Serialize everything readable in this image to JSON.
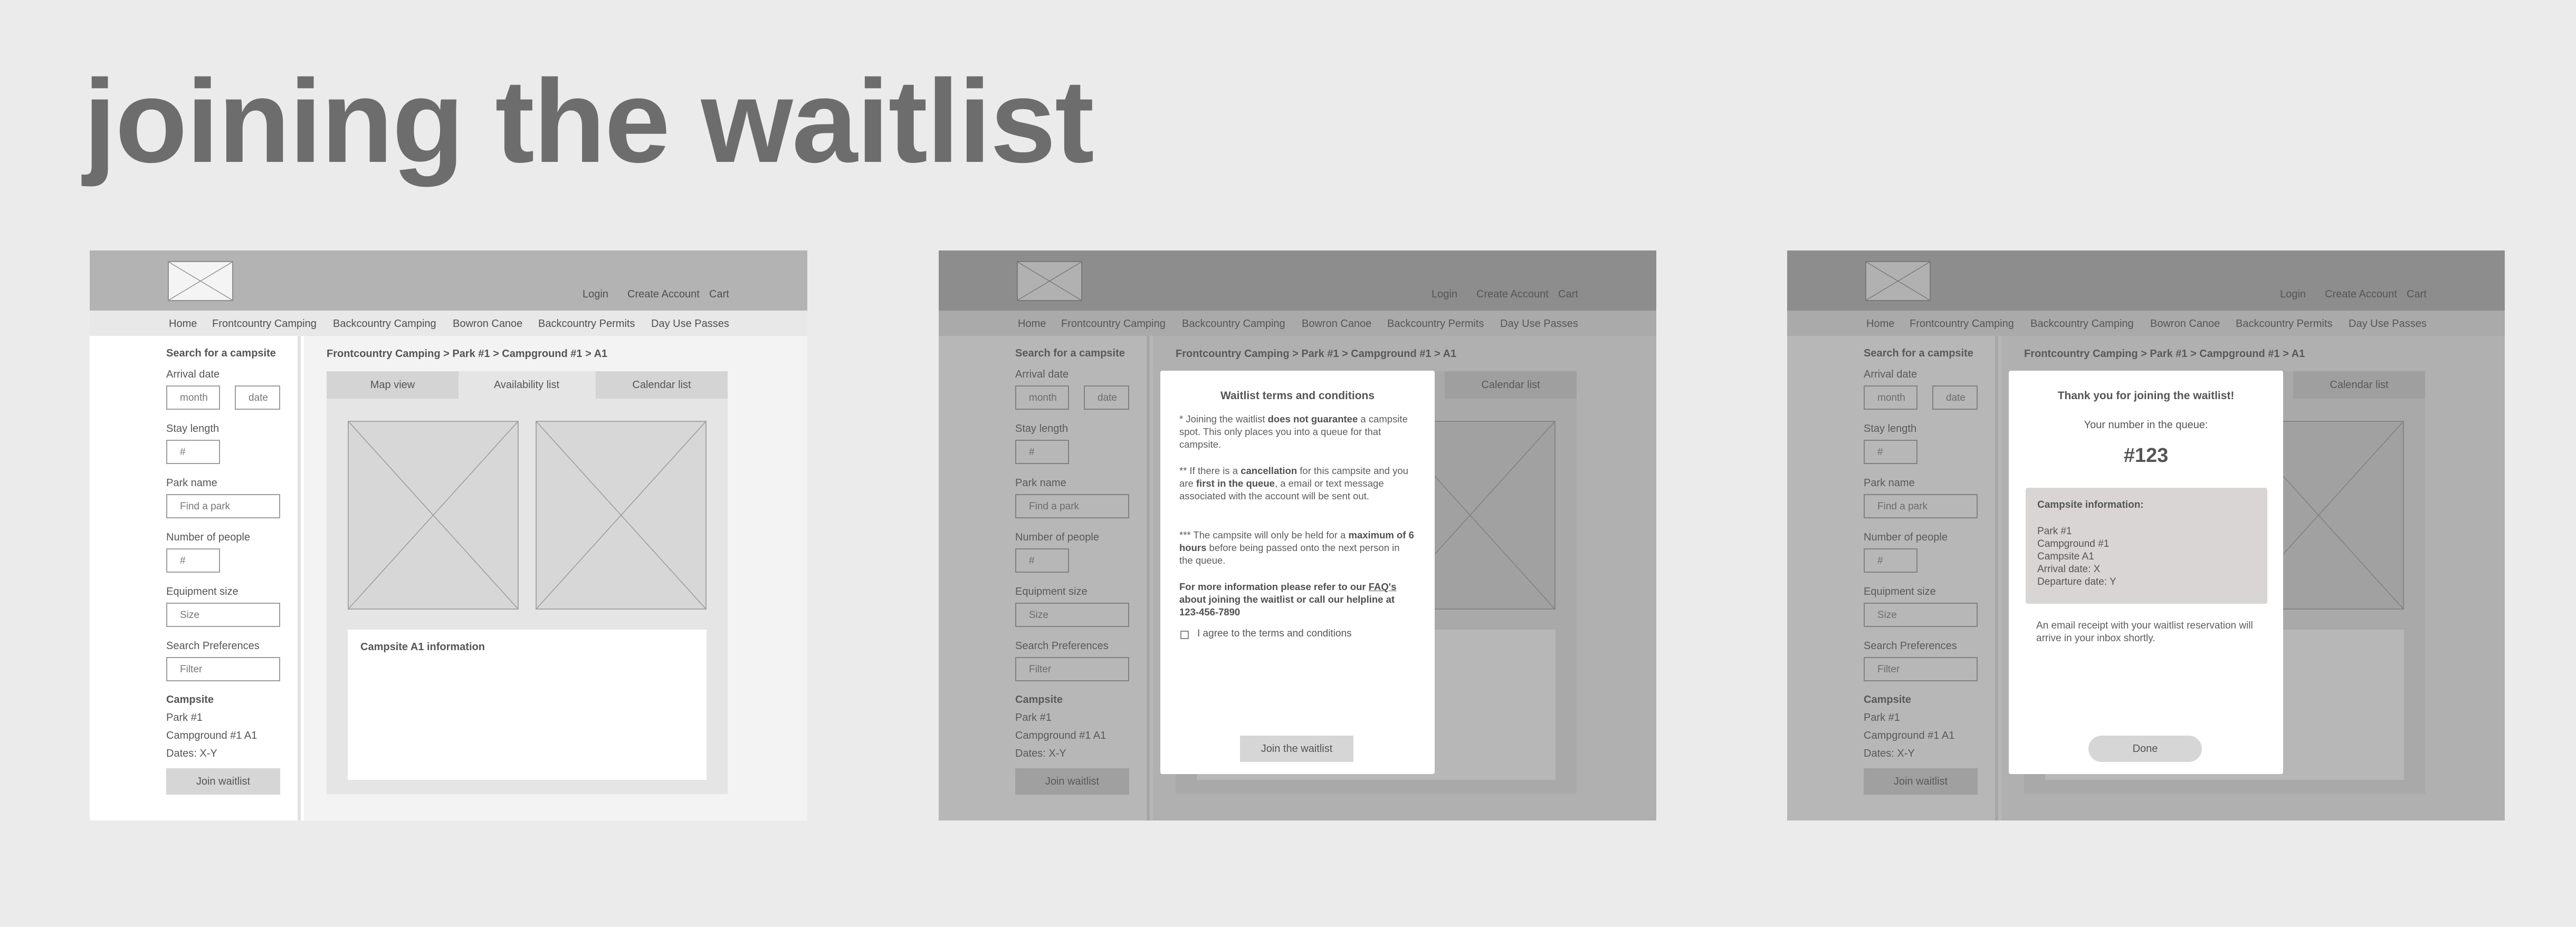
{
  "title": "joining the waitlist",
  "header": {
    "login": "Login",
    "create_account": "Create Account",
    "cart": "Cart"
  },
  "nav": {
    "home": "Home",
    "frontcountry": "Frontcountry Camping",
    "backcountry": "Backcountry Camping",
    "bowron": "Bowron Canoe",
    "permits": "Backcountry Permits",
    "day_use": "Day Use Passes"
  },
  "sidebar": {
    "heading": "Search for a campsite",
    "arrival_label": "Arrival date",
    "month_placeholder": "month",
    "date_placeholder": "date",
    "stay_label": "Stay length",
    "stay_placeholder": "#",
    "park_label": "Park name",
    "park_placeholder": "Find a park",
    "people_label": "Number of people",
    "people_placeholder": "#",
    "equipment_label": "Equipment size",
    "equipment_placeholder": "Size",
    "prefs_label": "Search Preferences",
    "prefs_placeholder": "Filter",
    "campsite_heading": "Campsite",
    "park": "Park #1",
    "campground": "Campground #1 A1",
    "dates": "Dates: X-Y",
    "join_button": "Join waitlist"
  },
  "main": {
    "breadcrumb": "Frontcountry Camping > Park #1 > Campground #1 > A1",
    "tabs": [
      "Map view",
      "Availability list",
      "Calendar list"
    ],
    "info_title": "Campsite A1 information"
  },
  "terms_modal": {
    "title": "Waitlist terms and conditions",
    "p1_a": "* Joining the waitlist ",
    "p1_b": "does not guarantee",
    "p1_c": " a campsite spot. This only places you into a queue for that campsite.",
    "p2_a": "** If there is a ",
    "p2_b": "cancellation",
    "p2_c": " for this campsite and you are ",
    "p2_d": "first in the queue",
    "p2_e": ", a email or text message associated with the account will be sent out.",
    "p3_a": "*** The campsite will only be held for a ",
    "p3_b": "maximum of 6 hours",
    "p3_c": " before being passed onto the next person in the queue.",
    "p4_a": "For more information please refer to our ",
    "p4_link": "FAQ's",
    "p4_b": " about joining the waitlist or call our helpline at 123-456-7890",
    "checkbox_label": "I agree to the terms and conditions",
    "button": "Join the waitlist"
  },
  "confirm_modal": {
    "title": "Thank you for joining the waitlist!",
    "queue_label": "Your number in the queue:",
    "queue_number": "#123",
    "info_title": "Campsite information:",
    "park": "Park #1",
    "campground": "Campground #1",
    "campsite": "Campsite A1",
    "arrival": "Arrival date: X",
    "departure": "Departure date: Y",
    "receipt_note": "An email receipt with your waitlist reservation will arrive in your inbox shortly.",
    "button": "Done"
  }
}
